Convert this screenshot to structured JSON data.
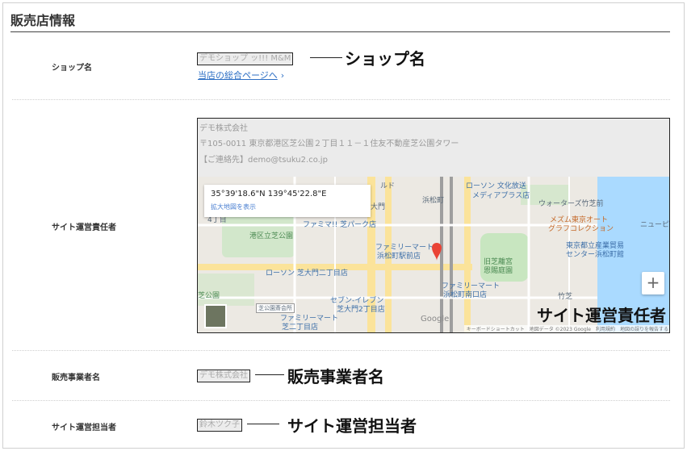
{
  "section": {
    "title": "販売店情報"
  },
  "rows": {
    "shop_name": {
      "label": "ショップ名",
      "value": "デモショップ ッ!!! M&M",
      "callout": "ショップ名",
      "link": "当店の総合ページへ"
    },
    "operator": {
      "label": "サイト運営責任者",
      "company": "デモ株式会社",
      "address": "〒105-0011 東京都港区芝公園２丁目１１－１住友不動産芝公園タワー",
      "contact": "【ご連絡先】demo@tsuku2.co.jp",
      "callout": "サイト運営責任者",
      "map": {
        "coords": "35°39'18.6\"N 139°45'22.8\"E",
        "enlarge_link": "拡大地図を表示",
        "zoom_in": "+",
        "google": "Google",
        "attribution": "キーボードショートカット　地図データ ©2023 Google　利用規約　地図の誤りを報告する",
        "labels": {
          "hamamatsucho": "浜松町",
          "daimon": "大門",
          "lawson_bunka": "ローソン 文化放送",
          "media_plus": "メディアプラス店",
          "waters": "ウォーターズ竹芝前",
          "mesm": "メズム東京オート",
          "graph": "グラフコレクション",
          "newpier": "ニューピア",
          "family_shiba": "ファミマ!! 芝パーク店",
          "minato_park": "港区立芝公園",
          "family_hama": "ファミリーマート",
          "family_hama2": "浜松町駅前店",
          "kyu_shiba": "旧芝離宮",
          "kyu_shiba2": "恩賜庭園",
          "tokyo_trade": "東京都立産業貿易",
          "tokyo_trade2": "センター浜松町館",
          "lawson_daimon": "ローソン 芝大門二丁目店",
          "family_hamaminami": "ファミリーマート",
          "family_hamaminami2": "浜松町南口店",
          "seven": "セブン-イレブン",
          "seven2": "芝大門2丁目店",
          "shiba_park": "芝公園",
          "shiba_park_hall": "芝公園斎会所",
          "family_shiba2": "ファミリーマート",
          "family_shiba2b": "芝二丁目店",
          "takeshiba": "竹芝",
          "fourth": "4丁目",
          "bldg": "ルド"
        }
      }
    },
    "seller": {
      "label": "販売事業者名",
      "value": "デモ株式会社",
      "callout": "販売事業者名"
    },
    "manager": {
      "label": "サイト運営担当者",
      "value": "鈴木ツク子",
      "callout": "サイト運営担当者"
    }
  },
  "colors": {
    "link": "#2d6fc4",
    "map_water": "#aadaff",
    "map_park": "#c8e6c0",
    "map_road": "#fbe39a",
    "map_rail": "#9e9e9e",
    "map_pin": "#ea4335"
  }
}
